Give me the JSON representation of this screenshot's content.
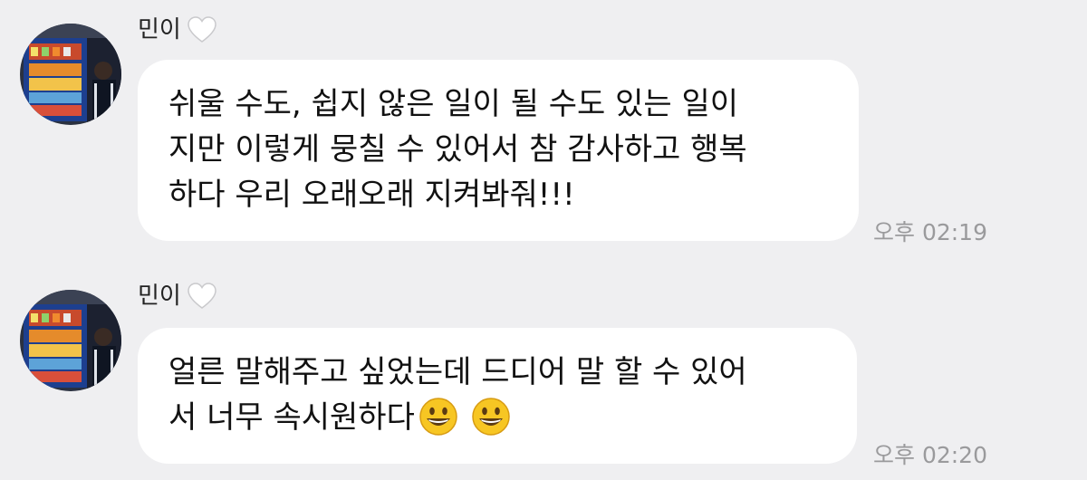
{
  "messages": [
    {
      "sender": "민이",
      "avatar_icon": "profile-photo",
      "heart_icon": "white-heart",
      "text": "쉬울 수도, 쉽지 않은 일이 될 수도 있는 일이\n지만 이렇게 뭉칠 수 있어서 참 감사하고 행복\n하다 우리 오래오래 지켜봐줘!!!",
      "time": "오후 02:19"
    },
    {
      "sender": "민이",
      "avatar_icon": "profile-photo",
      "heart_icon": "white-heart",
      "text": "얼른 말해주고 싶었는데 드디어 말 할 수 있어\n서 너무 속시원하다",
      "emojis": [
        "grinning-face",
        "grinning-face"
      ],
      "time": "오후 02:20"
    }
  ],
  "colors": {
    "background": "#efeff1",
    "bubble": "#ffffff",
    "timestamp": "#9a9a9c",
    "emoji_yellow": "#f7c623"
  }
}
